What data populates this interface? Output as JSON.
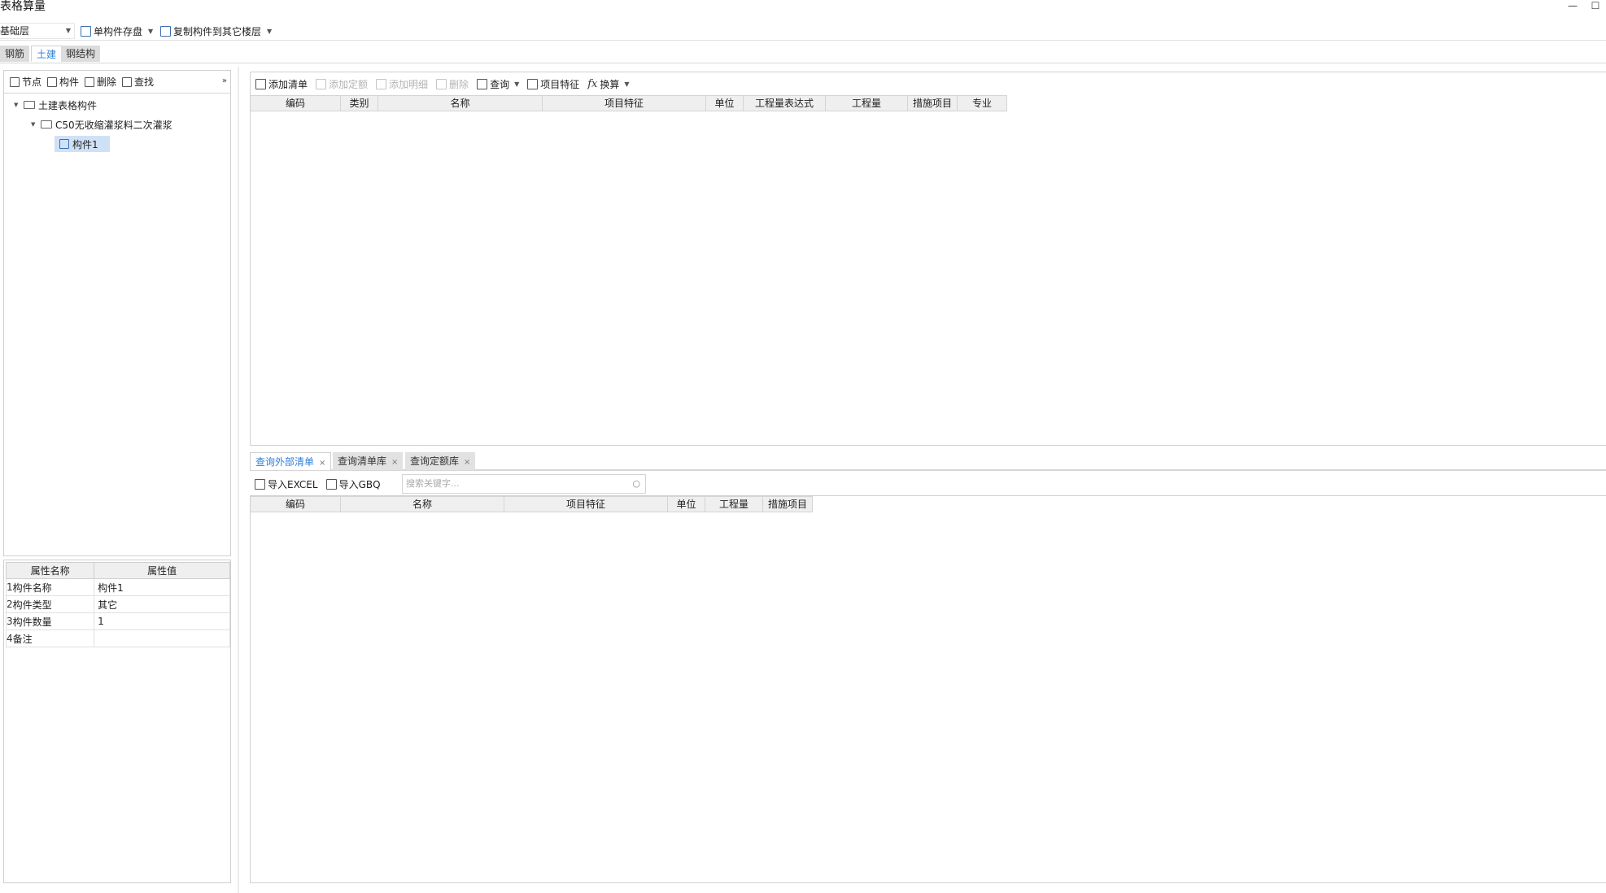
{
  "window": {
    "title": "表格算量",
    "minimize_glyph": "—",
    "maximize_glyph": "☐"
  },
  "topbar": {
    "layer_value": "基础层",
    "save_component_label": "单构件存盘",
    "copy_component_label": "复制构件到其它楼层"
  },
  "main_tabs": [
    "钢筋",
    "土建",
    "钢结构"
  ],
  "active_main_tab": "土建",
  "left_toolbar": {
    "node": "节点",
    "component": "构件",
    "delete": "删除",
    "find": "查找",
    "more": "»"
  },
  "tree": {
    "root": "土建表格构件",
    "group": "C50无收缩灌浆料二次灌浆",
    "item": "构件1"
  },
  "properties": {
    "headers": [
      "属性名称",
      "属性值"
    ],
    "rows": [
      {
        "num": "1",
        "name": "构件名称",
        "value": "构件1"
      },
      {
        "num": "2",
        "name": "构件类型",
        "value": "其它"
      },
      {
        "num": "3",
        "name": "构件数量",
        "value": "1"
      },
      {
        "num": "4",
        "name": "备注",
        "value": ""
      }
    ]
  },
  "right_toolbar": {
    "add_bill": "添加清单",
    "add_quota": "添加定额",
    "add_detail": "添加明细",
    "delete": "删除",
    "query": "查询",
    "project_feature": "项目特征",
    "convert": "换算",
    "fx_glyph": "fx"
  },
  "top_grid_headers": [
    "编码",
    "类别",
    "名称",
    "项目特征",
    "单位",
    "工程量表达式",
    "工程量",
    "措施项目",
    "专业"
  ],
  "bottom_tabs": [
    {
      "label": "查询外部清单"
    },
    {
      "label": "查询清单库"
    },
    {
      "label": "查询定额库"
    }
  ],
  "bottom_toolbar": {
    "import_excel": "导入EXCEL",
    "import_gbq": "导入GBQ",
    "search_placeholder": "搜索关键字..."
  },
  "bottom_grid_headers": [
    "编码",
    "名称",
    "项目特征",
    "单位",
    "工程量",
    "措施项目"
  ]
}
